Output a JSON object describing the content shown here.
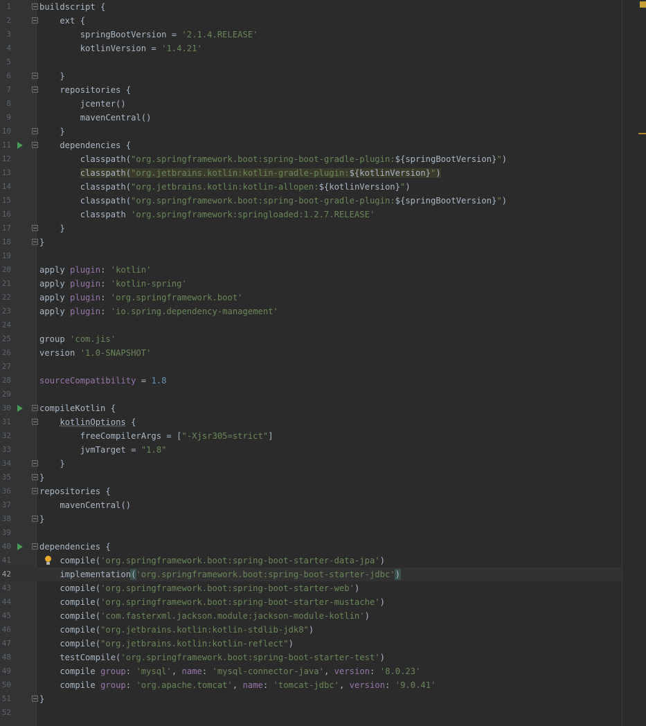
{
  "editor": {
    "current_line": "42",
    "lines": [
      {
        "n": "1",
        "text": "buildscript {",
        "fold": true,
        "tokens": [
          [
            "",
            "buildscript {"
          ]
        ]
      },
      {
        "n": "2",
        "text": "    ext {",
        "fold": true,
        "tokens": [
          [
            "",
            "    ext {"
          ]
        ]
      },
      {
        "n": "3",
        "tokens": [
          [
            "",
            "        springBootVersion = "
          ],
          [
            "s",
            "'2.1.4.RELEASE'"
          ]
        ]
      },
      {
        "n": "4",
        "tokens": [
          [
            "",
            "        kotlinVersion = "
          ],
          [
            "s",
            "'1.4.21'"
          ]
        ]
      },
      {
        "n": "5",
        "tokens": [
          [
            "",
            ""
          ]
        ]
      },
      {
        "n": "6",
        "fold": true,
        "tokens": [
          [
            "",
            "    }"
          ]
        ]
      },
      {
        "n": "7",
        "fold": true,
        "tokens": [
          [
            "",
            "    repositories {"
          ]
        ]
      },
      {
        "n": "8",
        "tokens": [
          [
            "",
            "        jcenter()"
          ]
        ]
      },
      {
        "n": "9",
        "tokens": [
          [
            "",
            "        mavenCentral()"
          ]
        ]
      },
      {
        "n": "10",
        "fold": true,
        "tokens": [
          [
            "",
            "    }"
          ]
        ]
      },
      {
        "n": "11",
        "fold": true,
        "run": true,
        "tokens": [
          [
            "",
            "    dependencies {"
          ]
        ]
      },
      {
        "n": "12",
        "tokens": [
          [
            "",
            "        classpath("
          ],
          [
            "s",
            "\"org.springframework.boot:spring-boot-gradle-plugin:"
          ],
          [
            "",
            "${springBootVersion}"
          ],
          [
            "s",
            "\""
          ],
          [
            "",
            ")"
          ]
        ]
      },
      {
        "n": "13",
        "highlight": true,
        "tokens": [
          [
            "",
            "        "
          ],
          [
            "hl",
            "classpath("
          ],
          [
            "hls",
            "\"org.jetbrains.kotlin:kotlin-gradle-plugin:"
          ],
          [
            "hl",
            "${kotlinVersion}"
          ],
          [
            "hls",
            "\""
          ],
          [
            "hl",
            ")"
          ]
        ]
      },
      {
        "n": "14",
        "tokens": [
          [
            "",
            "        classpath("
          ],
          [
            "s",
            "\"org.jetbrains.kotlin:kotlin-allopen:"
          ],
          [
            "",
            "${kotlinVersion}"
          ],
          [
            "s",
            "\""
          ],
          [
            "",
            ")"
          ]
        ]
      },
      {
        "n": "15",
        "tokens": [
          [
            "",
            "        classpath("
          ],
          [
            "s",
            "\"org.springframework.boot:spring-boot-gradle-plugin:"
          ],
          [
            "",
            "${springBootVersion}"
          ],
          [
            "s",
            "\""
          ],
          [
            "",
            ")"
          ]
        ]
      },
      {
        "n": "16",
        "tokens": [
          [
            "",
            "        classpath "
          ],
          [
            "s",
            "'org.springframework:springloaded:1.2.7.RELEASE'"
          ]
        ]
      },
      {
        "n": "17",
        "fold": true,
        "tokens": [
          [
            "",
            "    }"
          ]
        ]
      },
      {
        "n": "18",
        "fold": true,
        "tokens": [
          [
            "",
            "}"
          ]
        ]
      },
      {
        "n": "19",
        "tokens": [
          [
            "",
            ""
          ]
        ]
      },
      {
        "n": "20",
        "tokens": [
          [
            "",
            "apply "
          ],
          [
            "p",
            "plugin"
          ],
          [
            "",
            ": "
          ],
          [
            "s",
            "'kotlin'"
          ]
        ]
      },
      {
        "n": "21",
        "tokens": [
          [
            "",
            "apply "
          ],
          [
            "p",
            "plugin"
          ],
          [
            "",
            ": "
          ],
          [
            "s",
            "'kotlin-spring'"
          ]
        ]
      },
      {
        "n": "22",
        "tokens": [
          [
            "",
            "apply "
          ],
          [
            "p",
            "plugin"
          ],
          [
            "",
            ": "
          ],
          [
            "s",
            "'org.springframework.boot'"
          ]
        ]
      },
      {
        "n": "23",
        "tokens": [
          [
            "",
            "apply "
          ],
          [
            "p",
            "plugin"
          ],
          [
            "",
            ": "
          ],
          [
            "s",
            "'io.spring.dependency-management'"
          ]
        ]
      },
      {
        "n": "24",
        "tokens": [
          [
            "",
            ""
          ]
        ]
      },
      {
        "n": "25",
        "tokens": [
          [
            "",
            "group "
          ],
          [
            "s",
            "'com.jis'"
          ]
        ]
      },
      {
        "n": "26",
        "tokens": [
          [
            "",
            "version "
          ],
          [
            "s",
            "'1.0-SNAPSHOT'"
          ]
        ]
      },
      {
        "n": "27",
        "tokens": [
          [
            "",
            ""
          ]
        ]
      },
      {
        "n": "28",
        "tokens": [
          [
            "p",
            "sourceCompatibility"
          ],
          [
            "",
            " = "
          ],
          [
            "n",
            "1.8"
          ]
        ]
      },
      {
        "n": "29",
        "tokens": [
          [
            "",
            ""
          ]
        ]
      },
      {
        "n": "30",
        "fold": true,
        "run": true,
        "tokens": [
          [
            "",
            "compileKotlin {"
          ]
        ]
      },
      {
        "n": "31",
        "fold": true,
        "tokens": [
          [
            "",
            "    "
          ],
          [
            "w",
            "kotlinOptions"
          ],
          [
            "",
            " {"
          ]
        ]
      },
      {
        "n": "32",
        "tokens": [
          [
            "",
            "        freeCompilerArgs = ["
          ],
          [
            "s",
            "\"-Xjsr305=strict\""
          ],
          [
            "",
            "]"
          ]
        ]
      },
      {
        "n": "33",
        "tokens": [
          [
            "",
            "        jvmTarget = "
          ],
          [
            "s",
            "\"1.8\""
          ]
        ]
      },
      {
        "n": "34",
        "fold": true,
        "tokens": [
          [
            "",
            "    }"
          ]
        ]
      },
      {
        "n": "35",
        "fold": true,
        "tokens": [
          [
            "",
            "}"
          ]
        ]
      },
      {
        "n": "36",
        "fold": true,
        "tokens": [
          [
            "",
            "repositories {"
          ]
        ]
      },
      {
        "n": "37",
        "tokens": [
          [
            "",
            "    mavenCentral()"
          ]
        ]
      },
      {
        "n": "38",
        "fold": true,
        "tokens": [
          [
            "",
            "}"
          ]
        ]
      },
      {
        "n": "39",
        "tokens": [
          [
            "",
            ""
          ]
        ]
      },
      {
        "n": "40",
        "fold": true,
        "run": true,
        "tokens": [
          [
            "",
            "dependencies {"
          ]
        ]
      },
      {
        "n": "41",
        "bulb": true,
        "tokens": [
          [
            "",
            "    compile("
          ],
          [
            "s",
            "'org.springframework.boot:spring-boot-starter-data-jpa'"
          ],
          [
            "",
            ")"
          ]
        ]
      },
      {
        "n": "42",
        "current": true,
        "tokens": [
          [
            "",
            "    implementation"
          ],
          [
            "bm",
            "("
          ],
          [
            "s",
            "'org.springframework.boot:spring-boot-starter-jdbc'"
          ],
          [
            "bm",
            ")"
          ]
        ]
      },
      {
        "n": "43",
        "tokens": [
          [
            "",
            "    compile("
          ],
          [
            "s",
            "'org.springframework.boot:spring-boot-starter-web'"
          ],
          [
            "",
            ")"
          ]
        ]
      },
      {
        "n": "44",
        "tokens": [
          [
            "",
            "    compile("
          ],
          [
            "s",
            "'org.springframework.boot:spring-boot-starter-mustache'"
          ],
          [
            "",
            ")"
          ]
        ]
      },
      {
        "n": "45",
        "tokens": [
          [
            "",
            "    compile("
          ],
          [
            "s",
            "'com.fasterxml.jackson.module:jackson-module-kotlin'"
          ],
          [
            "",
            ")"
          ]
        ]
      },
      {
        "n": "46",
        "tokens": [
          [
            "",
            "    compile("
          ],
          [
            "s",
            "\"org.jetbrains.kotlin:kotlin-stdlib-jdk8\""
          ],
          [
            "",
            ")"
          ]
        ]
      },
      {
        "n": "47",
        "tokens": [
          [
            "",
            "    compile("
          ],
          [
            "s",
            "\"org.jetbrains.kotlin:kotlin-reflect\""
          ],
          [
            "",
            ")"
          ]
        ]
      },
      {
        "n": "48",
        "tokens": [
          [
            "",
            "    testCompile("
          ],
          [
            "s",
            "'org.springframework.boot:spring-boot-starter-test'"
          ],
          [
            "",
            ")"
          ]
        ]
      },
      {
        "n": "49",
        "tokens": [
          [
            "",
            "    compile "
          ],
          [
            "p",
            "group"
          ],
          [
            "",
            ": "
          ],
          [
            "s",
            "'mysql'"
          ],
          [
            "",
            ", "
          ],
          [
            "p",
            "name"
          ],
          [
            "",
            ": "
          ],
          [
            "s",
            "'mysql-connector-java'"
          ],
          [
            "",
            ", "
          ],
          [
            "p",
            "version"
          ],
          [
            "",
            ": "
          ],
          [
            "s",
            "'8.0.23'"
          ]
        ]
      },
      {
        "n": "50",
        "tokens": [
          [
            "",
            "    compile "
          ],
          [
            "p",
            "group"
          ],
          [
            "",
            ": "
          ],
          [
            "s",
            "'org.apache.tomcat'"
          ],
          [
            "",
            ", "
          ],
          [
            "p",
            "name"
          ],
          [
            "",
            ": "
          ],
          [
            "s",
            "'tomcat-jdbc'"
          ],
          [
            "",
            ", "
          ],
          [
            "p",
            "version"
          ],
          [
            "",
            ": "
          ],
          [
            "s",
            "'9.0.41'"
          ]
        ]
      },
      {
        "n": "51",
        "fold": true,
        "tokens": [
          [
            "",
            "}"
          ]
        ]
      },
      {
        "n": "52",
        "tokens": [
          [
            "",
            ""
          ]
        ]
      }
    ]
  },
  "colors": {
    "background": "#2b2b2b",
    "gutter": "#313335",
    "string": "#6a8759",
    "number": "#6897bb",
    "property": "#9876aa",
    "text": "#a9b7c6",
    "warning_marker": "#c7a035"
  },
  "icons": {
    "run": "run-gutter-icon",
    "fold": "fold-marker-icon",
    "bulb": "intention-bulb-icon"
  }
}
